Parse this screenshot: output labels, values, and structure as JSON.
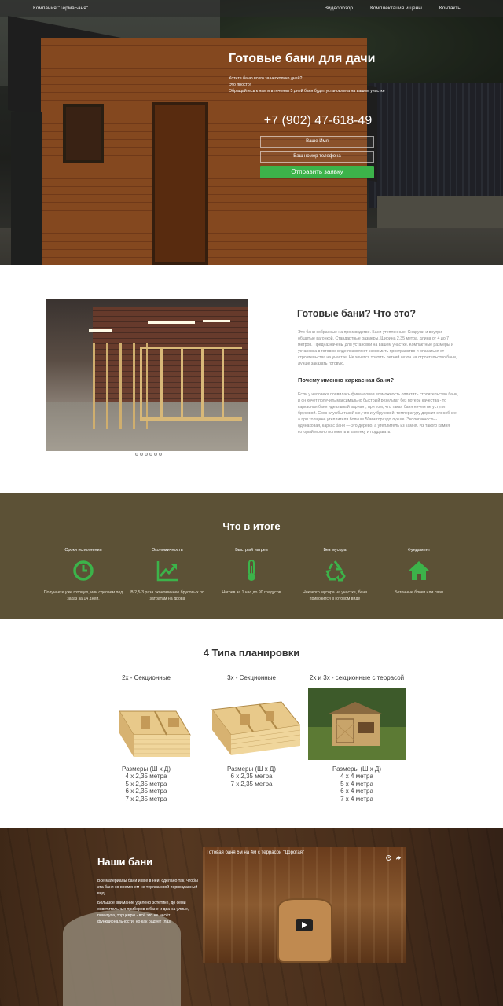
{
  "nav": {
    "brand": "Компания \"ТермаБаня\"",
    "links": [
      "Видеообзор",
      "Комплектация и цены",
      "Контакты"
    ]
  },
  "hero": {
    "title": "Готовые бани для дачи",
    "subtitle_lines": [
      "Хотите баню всего за несколько дней?",
      "Это просто!",
      "Обращайтесь к нам и в течении 5 дней баня будет установлена на вашем участке"
    ],
    "phone": "+7 (902) 47-618-49",
    "name_placeholder": "Ваше Имя",
    "phone_placeholder": "Ваш номер телефона",
    "submit_label": "Отправить заявку"
  },
  "about": {
    "title": "Готовые бани? Что это?",
    "text1": "Это бани собранные на производстве. Бани утепленные. Снаружи и внутри обшитые вагонкой. Стандартные размеры. Ширина 2,35 метра, длина от 4 до 7 метров. Предназначены для установки на вашем участке. Компактные размеры и установка в готовом виде позволяют экономить пространство и опасаться от строительства на участке. Не хочется тратить летний сезон на строительство бани, лучше заказать готовую.",
    "subtitle": "Почему именно каркасная баня?",
    "text2": "Если у человека появилась финансовая возможность оплатить строительство бани, и он хочет получить максимально быстрый результат без потери качества - то каркасная баня идеальный вариант, при том, что такая баня ничем не уступит брусовой. Срок службы такой же, что и у брусовой, температуру держит способнее, а при толщине утеплителя больше 50мм гораздо лучше. Экологичность - одинаковая, каркас бани — это дерево, а утеплитель из камня. Из такого камня, который можно положить в каменку и поддавать."
  },
  "results": {
    "title": "Что в итоге",
    "features": [
      {
        "heading": "Сроки исполнения",
        "icon": "clock-icon",
        "text": "Получаете уже готовую, или сделаем под заказ за 14 дней."
      },
      {
        "heading": "Экономичность",
        "icon": "trend-up-icon",
        "text": "В 2,5-3 раза экономичнее брусовых по затратам на дрова"
      },
      {
        "heading": "Быстрый нагрев",
        "icon": "thermometer-icon",
        "text": "Нагрев за 1 час до 90 градусов"
      },
      {
        "heading": "Без мусора",
        "icon": "recycle-icon",
        "text": "Никакого мусора на участке, баня привозится в готовом виде"
      },
      {
        "heading": "Фундамент",
        "icon": "home-icon",
        "text": "Бетонные блоки или сваи"
      }
    ],
    "accent_color": "#3cb34a"
  },
  "plans": {
    "title": "4 Типа планировки",
    "items": [
      {
        "name": "2х - Секционные",
        "size_heading": "Размеры (Ш х Д)",
        "sizes": [
          "4 х 2,35 метра",
          "5 х 2,35 метра",
          "6 х 2,35 метра",
          "7 х 2,35 метра"
        ]
      },
      {
        "name": "3х - Секционные",
        "size_heading": "Размеры (Ш х Д)",
        "sizes": [
          "6 х 2,35 метра",
          "7 х 2,35 метра"
        ]
      },
      {
        "name": "2х и 3х - секционные с террасой",
        "size_heading": "Размеры (Ш х Д)",
        "sizes": [
          "4 х 4 метра",
          "5 х 4 метра",
          "6 х 4 метра",
          "7 х 4 метра"
        ]
      }
    ]
  },
  "gallery": {
    "title": "Наши бани",
    "text1": "Все материалы бани и всё в ней, сделано так, чтобы эта баня со временем не теряла свой первозданный вид",
    "text2": "Большое внимание уделено эстетике, до семи осветительных приборов в бане и два на улице, плинтуса, торцевры - всё это не несёт функциональности, но как радует глаз.",
    "video_title": "Готовая баня 6м на 4м с террасой \"Дорогая\""
  },
  "slider_dots": 6
}
